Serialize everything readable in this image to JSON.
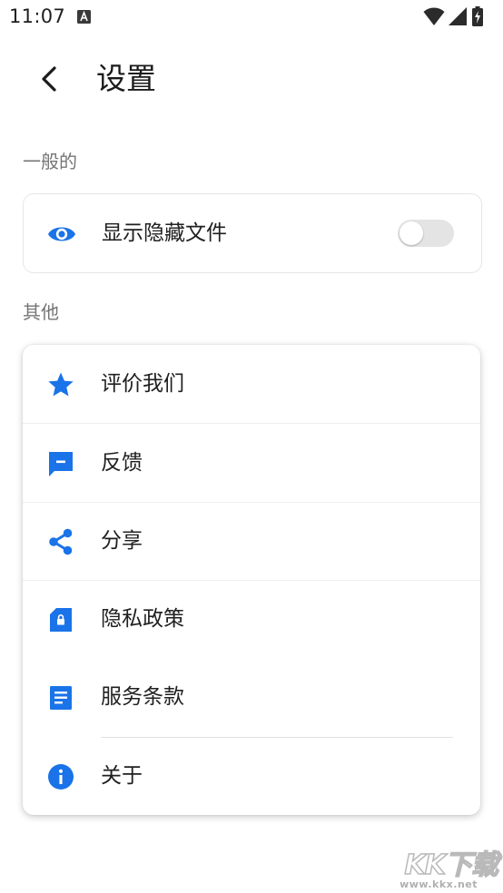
{
  "status_bar": {
    "time": "11:07",
    "icons": [
      "notification-a-icon",
      "wifi-icon",
      "signal-icon",
      "battery-charging-icon"
    ]
  },
  "header": {
    "back_icon": "chevron-left-icon",
    "title": "设置"
  },
  "sections": {
    "general": {
      "title": "一般的",
      "items": [
        {
          "icon": "eye-icon",
          "label": "显示隐藏文件",
          "toggle_on": false
        }
      ]
    },
    "other": {
      "title": "其他",
      "items": [
        {
          "icon": "star-icon",
          "label": "评价我们"
        },
        {
          "icon": "feedback-icon",
          "label": "反馈"
        },
        {
          "icon": "share-icon",
          "label": "分享"
        },
        {
          "icon": "privacy-lock-icon",
          "label": "隐私政策"
        },
        {
          "icon": "document-icon",
          "label": "服务条款"
        },
        {
          "icon": "info-icon",
          "label": "关于"
        }
      ]
    }
  },
  "watermark": {
    "logo": "KK下载",
    "url": "www.kkx.net"
  },
  "colors": {
    "accent": "#1a73e8",
    "section_header": "#757575",
    "toggle_off_track": "#e4e4e4",
    "divider": "#eeeeee"
  }
}
